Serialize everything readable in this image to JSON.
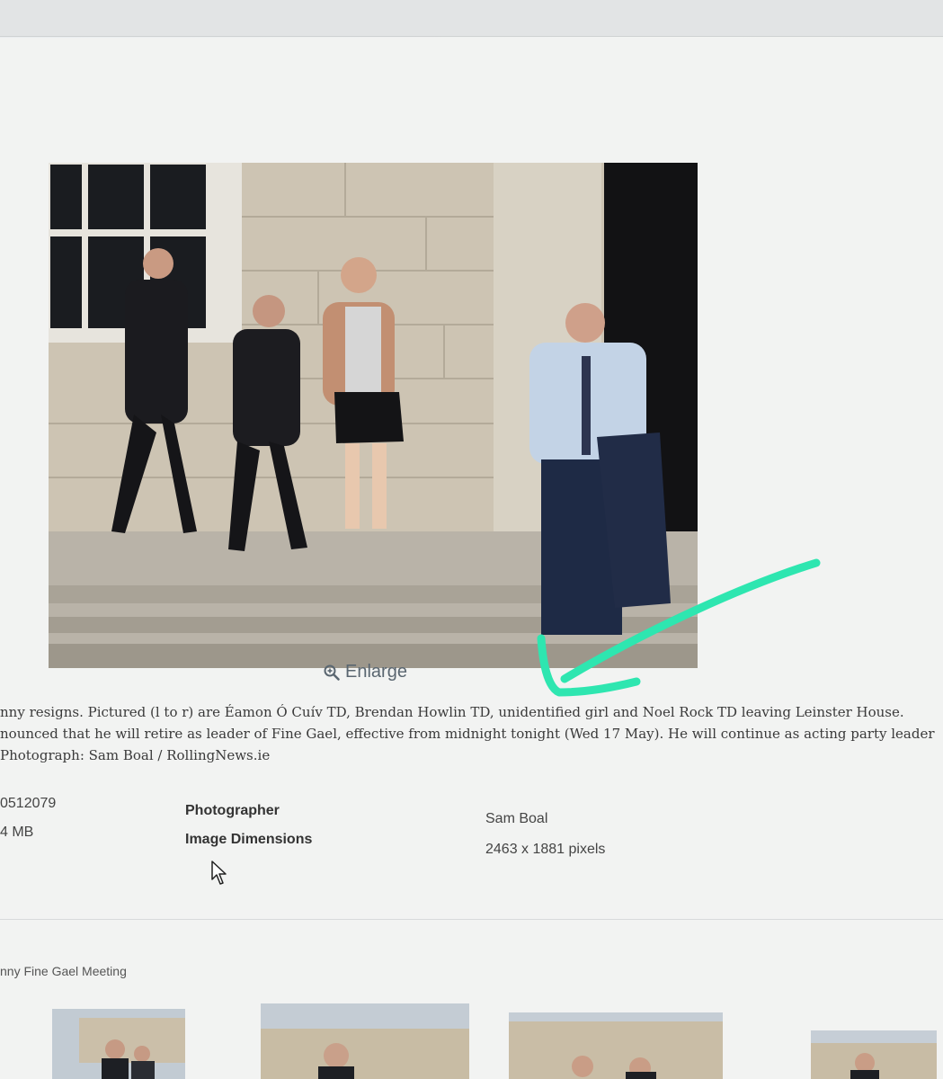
{
  "photo": {
    "enlarge_label": "Enlarge"
  },
  "caption": {
    "line1": "nny resigns. Pictured (l to r) are Éamon Ó Cuív TD, Brendan Howlin TD, unidentified girl and Noel Rock TD leaving Leinster House.",
    "line2": "nounced that he will retire as leader of Fine Gael, effective from midnight tonight (Wed 17 May). He will continue as acting party leader",
    "line3": "Photograph: Sam Boal / RollingNews.ie"
  },
  "details": {
    "image_id": "0512079",
    "file_size": "4 MB",
    "photographer_label": "Photographer",
    "photographer_value": "Sam Boal",
    "dimensions_label": "Image Dimensions",
    "dimensions_value": "2463 x 1881 pixels"
  },
  "gallery": {
    "title": "nny Fine Gael Meeting"
  },
  "annotation": {
    "arrow_color": "#2ee6b0"
  }
}
